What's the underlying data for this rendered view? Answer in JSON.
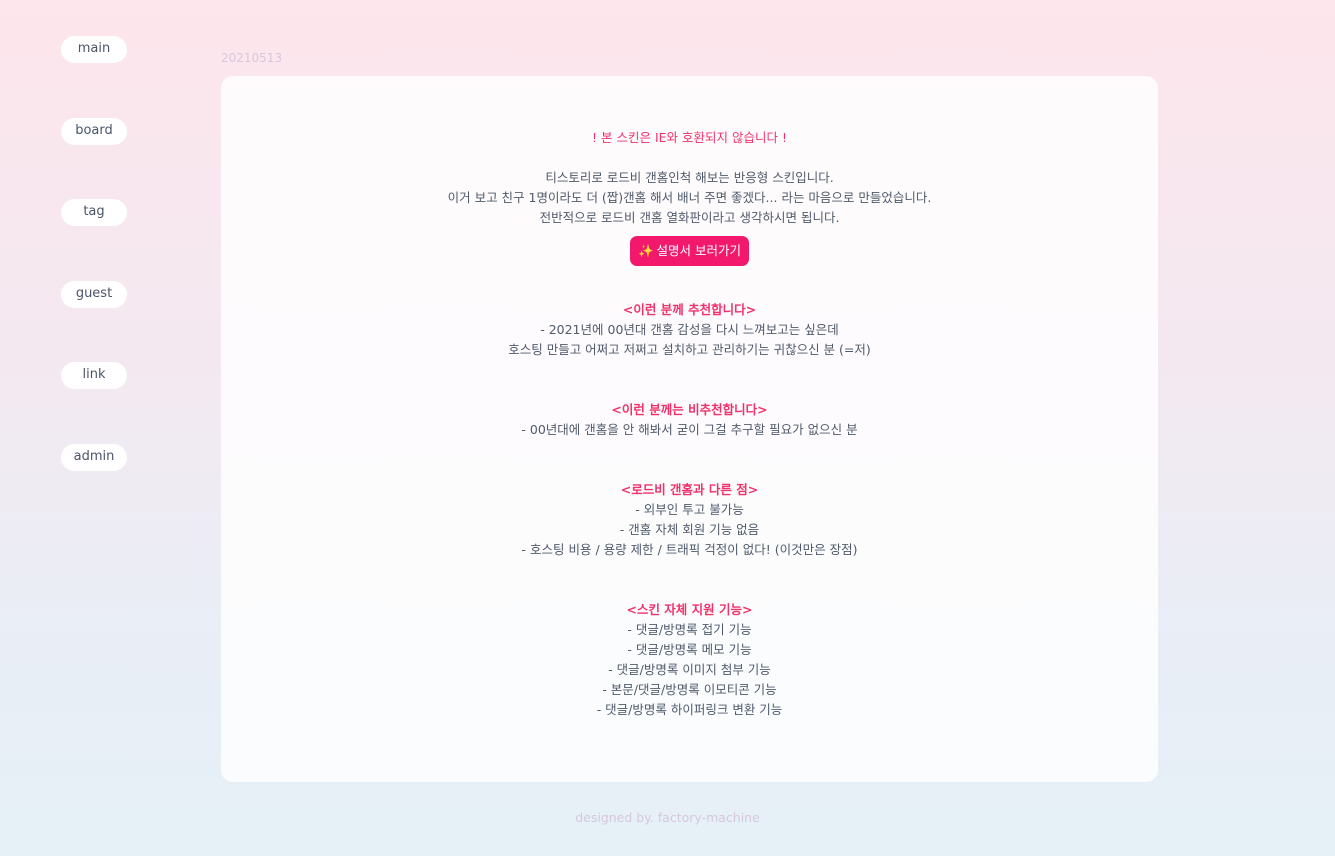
{
  "nav": {
    "items": [
      {
        "label": "main"
      },
      {
        "label": "board"
      },
      {
        "label": "tag"
      },
      {
        "label": "guest"
      },
      {
        "label": "link"
      },
      {
        "label": "admin"
      }
    ]
  },
  "post": {
    "date": "20210513",
    "warning": "! 본 스킨은 IE와 호환되지 않습니다 !",
    "intro": [
      "티스토리로 로드비 갠홈인척 해보는 반응형 스킨입니다.",
      "이거 보고 친구 1명이라도 더 (짭)갠홈 해서 배너 주면 좋겠다... 라는 마음으로 만들었습니다.",
      "전반적으로 로드비 갠홈 열화판이라고 생각하시면 됩니다."
    ],
    "manual_button": {
      "icon": "sparkles-icon",
      "icon_glyph": "✨",
      "label": "설명서 보러가기"
    },
    "sections": [
      {
        "title": "<이런 분께 추천합니다>",
        "lines": [
          "- 2021년에 00년대 갠홈 감성을 다시 느껴보고는 싶은데",
          "호스팅 만들고 어쩌고 저쩌고 설치하고 관리하기는 귀찮으신 분 (=저)"
        ]
      },
      {
        "title": "<이런 분께는 비추천합니다>",
        "lines": [
          "- 00년대에 갠홈을 안 해봐서 굳이 그걸 추구할 필요가 없으신 분"
        ]
      },
      {
        "title": "<로드비 갠홈과 다른 점>",
        "lines": [
          "- 외부인 투고 불가능",
          "- 갠홈 자체 회원 기능 없음",
          "- 호스팅 비용 / 용량 제한 / 트래픽 걱정이 없다! (이것만은 장점)"
        ]
      },
      {
        "title": "<스킨 자체 지원 기능>",
        "lines": [
          "- 댓글/방명록 접기 기능",
          "- 댓글/방명록 메모 기능",
          "- 댓글/방명록 이미지 첨부 기능",
          "- 본문/댓글/방명록 이모티콘 기능",
          "- 댓글/방명록 하이퍼링크 변환 기능"
        ]
      }
    ]
  },
  "footer": {
    "credit": "designed by. factory-machine"
  },
  "colors": {
    "accent": "#f2196c",
    "heading": "#f0326b",
    "text": "#4f5a6b"
  }
}
